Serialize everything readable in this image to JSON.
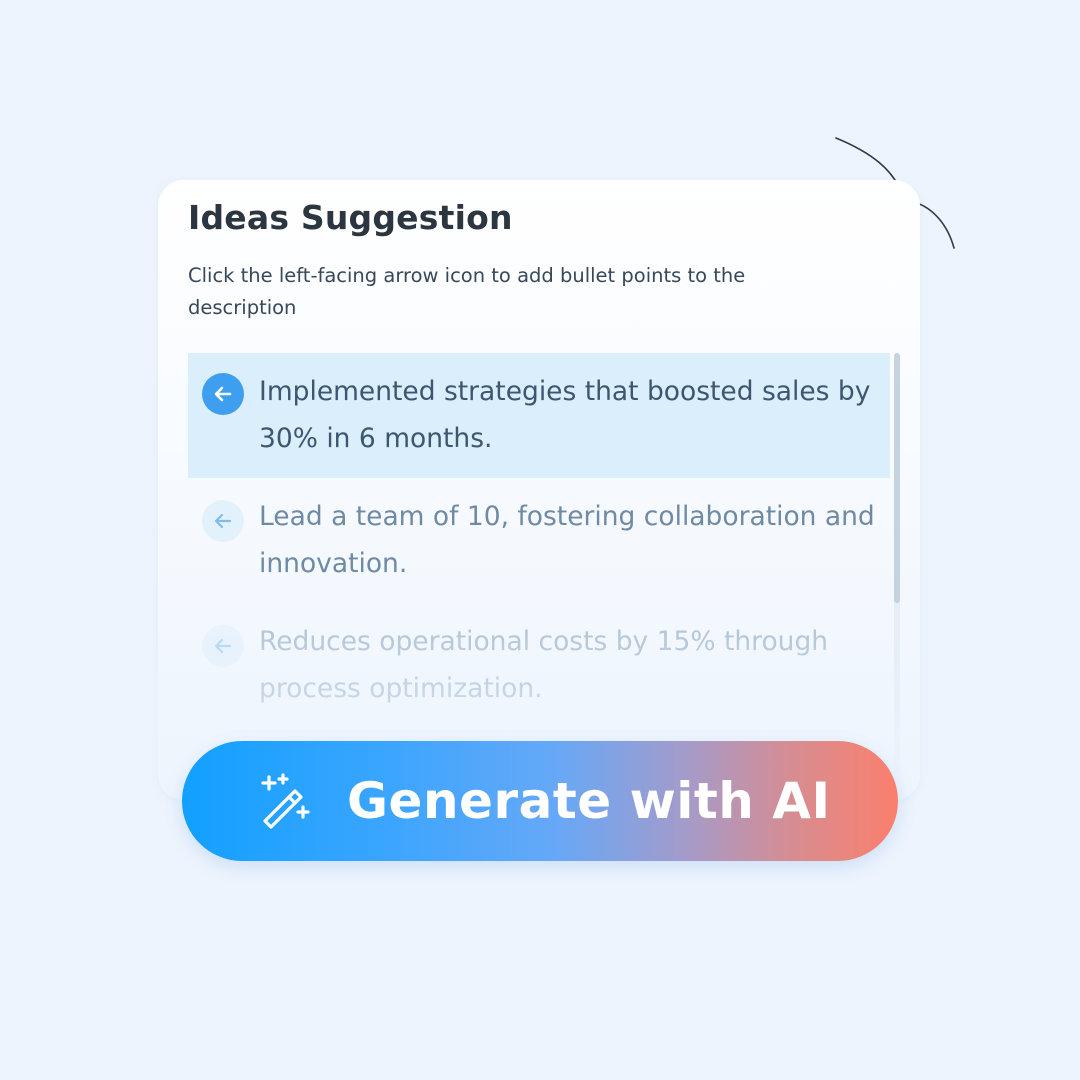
{
  "card": {
    "title": "Ideas Suggestion",
    "subtitle": "Click the left-facing arrow icon to add bullet points to the description"
  },
  "suggestions": [
    {
      "text": "Implemented strategies that boosted sales by 30% in 6 months.",
      "icon": "arrow-left-icon",
      "highlighted": true
    },
    {
      "text": "Lead a team of 10, fostering collaboration and innovation.",
      "icon": "arrow-left-icon",
      "highlighted": false
    },
    {
      "text": "Reduces operational costs by 15% through process optimization.",
      "icon": "arrow-left-icon",
      "highlighted": false
    }
  ],
  "generate_button": {
    "label": "Generate with AI",
    "icon": "magic-wand-icon"
  },
  "colors": {
    "background": "#edf4fd",
    "highlight": "#daeefc",
    "active_icon": "#3e9ff0",
    "button_gradient_start": "#12a0ff",
    "button_gradient_end": "#fb7f6d"
  }
}
